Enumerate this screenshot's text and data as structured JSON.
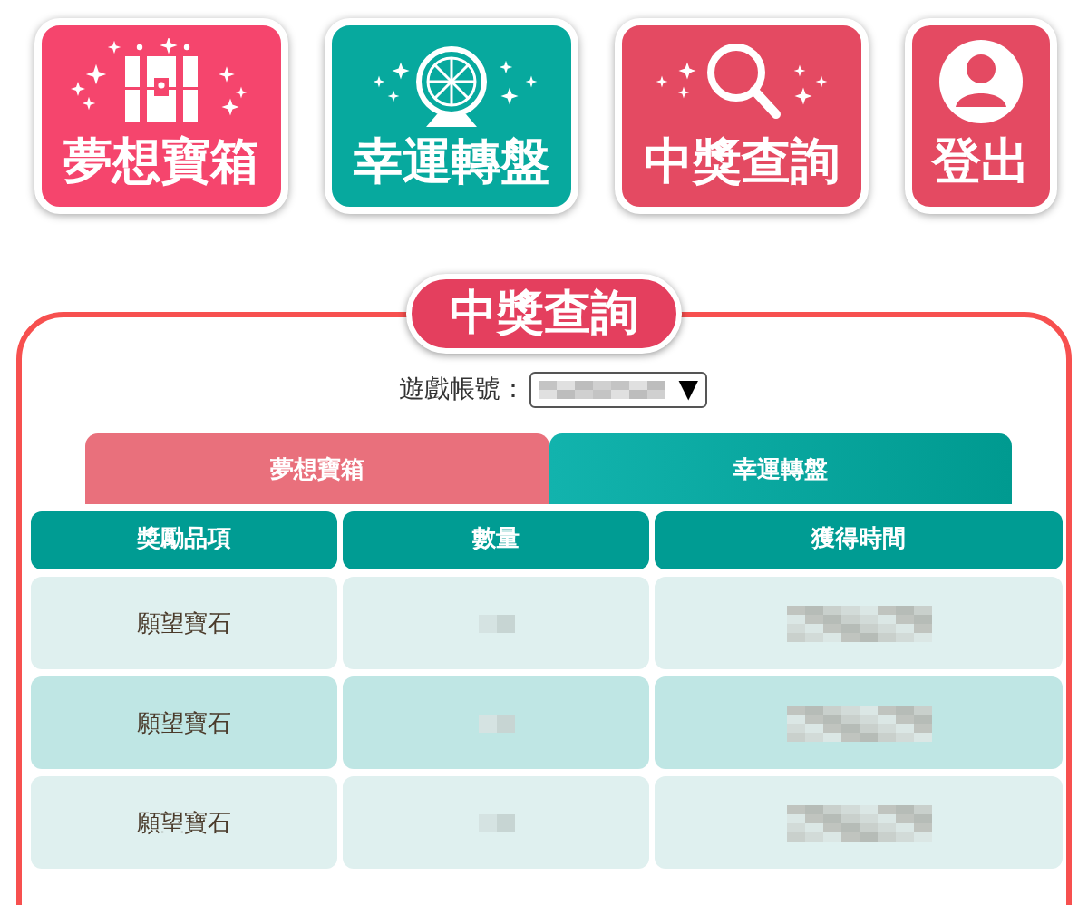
{
  "nav_buttons": [
    {
      "label": "夢想寶箱",
      "kind": "chest",
      "color": "#f5456d"
    },
    {
      "label": "幸運轉盤",
      "kind": "wheel",
      "color": "#07a99e"
    },
    {
      "label": "中獎查詢",
      "kind": "search",
      "color": "#e44a62"
    },
    {
      "label": "登出",
      "kind": "user",
      "color": "#e44a62"
    }
  ],
  "panel": {
    "title": "中獎查詢",
    "account": {
      "label": "遊戲帳號：",
      "arrow": "▼"
    },
    "tabs": [
      {
        "label": "夢想寶箱",
        "selected": true
      },
      {
        "label": "幸運轉盤",
        "selected": false
      }
    ],
    "table": {
      "columns": [
        "獎勵品項",
        "數量",
        "獲得時間"
      ],
      "rows": [
        {
          "item": "願望寶石"
        },
        {
          "item": "願望寶石"
        },
        {
          "item": "願望寶石"
        }
      ]
    }
  }
}
